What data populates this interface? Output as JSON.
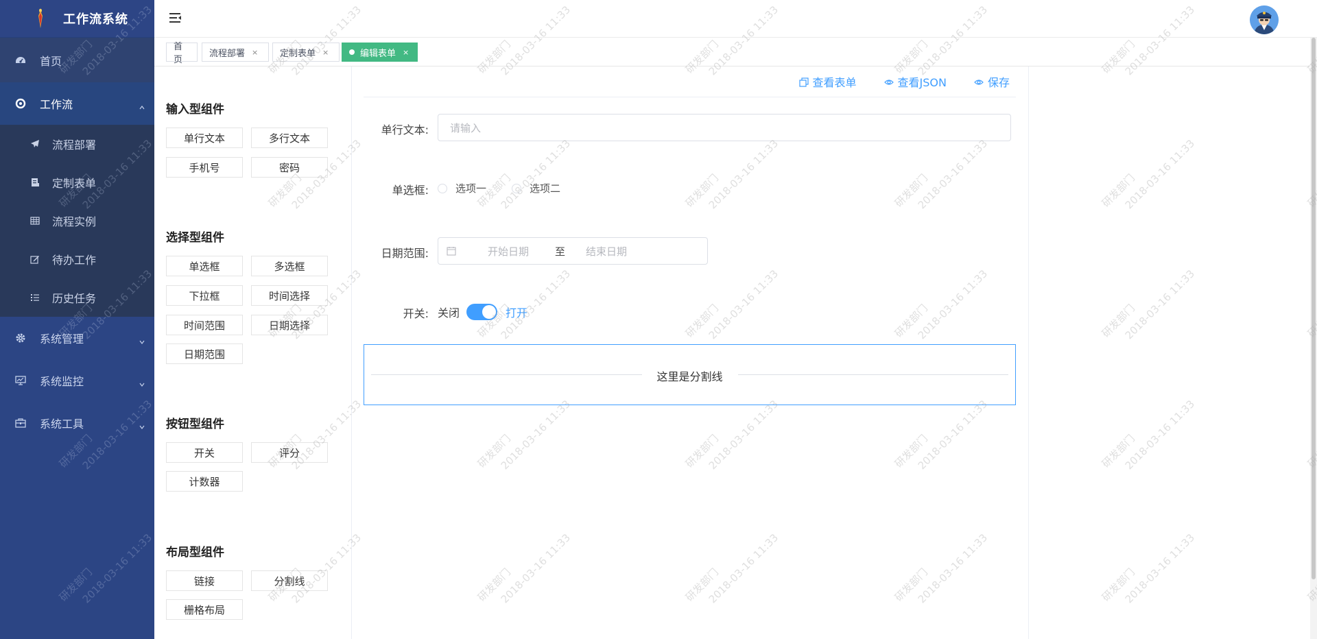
{
  "app": {
    "title": "工作流系统"
  },
  "sidebar": {
    "items": [
      {
        "label": "首页",
        "icon": "dashboard-icon"
      },
      {
        "label": "工作流",
        "icon": "workflow-icon",
        "expanded": true,
        "children": [
          {
            "label": "流程部署",
            "icon": "send-icon"
          },
          {
            "label": "定制表单",
            "icon": "form-icon"
          },
          {
            "label": "流程实例",
            "icon": "table-icon"
          },
          {
            "label": "待办工作",
            "icon": "edit-icon"
          },
          {
            "label": "历史任务",
            "icon": "list-icon"
          }
        ]
      },
      {
        "label": "系统管理",
        "icon": "gear-icon"
      },
      {
        "label": "系统监控",
        "icon": "monitor-icon"
      },
      {
        "label": "系统工具",
        "icon": "toolbox-icon"
      }
    ]
  },
  "tabs": [
    {
      "label": "首页",
      "closable": false
    },
    {
      "label": "流程部署",
      "close": "×"
    },
    {
      "label": "定制表单",
      "close": "×"
    },
    {
      "label": "编辑表单",
      "close": "×",
      "active": true
    }
  ],
  "palette": {
    "input_group": {
      "title": "输入型组件",
      "items": [
        "单行文本",
        "多行文本",
        "手机号",
        "密码"
      ]
    },
    "select_group": {
      "title": "选择型组件",
      "items": [
        "单选框",
        "多选框",
        "下拉框",
        "时间选择",
        "时间范围",
        "日期选择",
        "日期范围"
      ]
    },
    "button_group": {
      "title": "按钮型组件",
      "items": [
        "开关",
        "评分",
        "计数器"
      ]
    },
    "layout_group": {
      "title": "布局型组件",
      "items": [
        "链接",
        "分割线",
        "栅格布局"
      ]
    }
  },
  "actions": {
    "view_form": "查看表单",
    "view_json": "查看JSON",
    "save": "保存"
  },
  "form": {
    "text_label": "单行文本:",
    "text_placeholder": "请输入",
    "radio_label": "单选框:",
    "radio_options": [
      "选项一",
      "选项二"
    ],
    "date_label": "日期范围:",
    "date_start": "开始日期",
    "date_sep": "至",
    "date_end": "结束日期",
    "switch_label": "开关:",
    "switch_off": "关闭",
    "switch_on": "打开",
    "switch_state": true,
    "divider_text": "这里是分割线"
  },
  "watermark": {
    "line1": "研发部门",
    "line2": "2018-03-16 11:33"
  },
  "colors": {
    "sidebar": "#2c4584",
    "accent": "#409eff",
    "tab_active": "#42b983"
  }
}
